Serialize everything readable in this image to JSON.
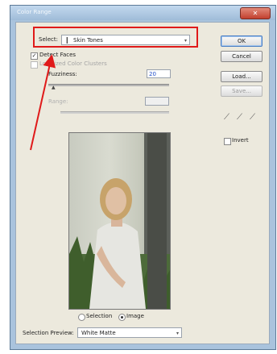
{
  "window": {
    "title": "Color Range",
    "close_label": "✕"
  },
  "select": {
    "label": "Select:",
    "value": "Skin Tones",
    "icon": "eyedropper-icon"
  },
  "options": {
    "detect_faces": {
      "label": "Detect Faces",
      "checked": true
    },
    "localized_clusters": {
      "label": "Localized Color Clusters",
      "checked": false
    }
  },
  "fuzziness": {
    "label": "Fuzziness:",
    "value": "20"
  },
  "range": {
    "label": "Range:",
    "value": ""
  },
  "buttons": {
    "ok": "OK",
    "cancel": "Cancel",
    "load": "Load...",
    "save": "Save..."
  },
  "invert": {
    "label": "Invert",
    "checked": false
  },
  "view": {
    "selection_label": "Selection",
    "image_label": "Image",
    "selected": "image"
  },
  "preview_mode": {
    "label": "Selection Preview:",
    "value": "White Matte"
  },
  "annotation": {
    "highlight_color": "#e01a1a",
    "arrow_color": "#e01a1a"
  }
}
